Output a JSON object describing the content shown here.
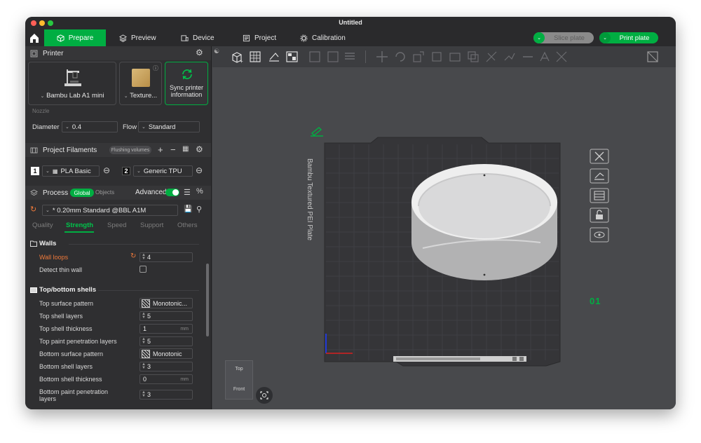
{
  "window": {
    "title": "Untitled"
  },
  "nav": {
    "tabs": [
      {
        "label": "Prepare",
        "active": true
      },
      {
        "label": "Preview"
      },
      {
        "label": "Device"
      },
      {
        "label": "Project"
      },
      {
        "label": "Calibration"
      }
    ],
    "slice_label": "Slice plate",
    "print_label": "Print plate"
  },
  "printer": {
    "section_title": "Printer",
    "model": "Bambu Lab A1 mini",
    "plate": "Texture...",
    "sync_label": "Sync printer information",
    "nozzle_label": "Nozzle",
    "diameter_label": "Diameter",
    "diameter_value": "0.4",
    "flow_label": "Flow",
    "flow_value": "Standard"
  },
  "filaments": {
    "section_title": "Project Filaments",
    "flushing_label": "Flushing volumes",
    "items": [
      {
        "index": "1",
        "name": "PLA Basic",
        "color": "#ffffff"
      },
      {
        "index": "2",
        "name": "Generic TPU",
        "color": "#111111"
      }
    ]
  },
  "process": {
    "section_title": "Process",
    "global_label": "Global",
    "objects_label": "Objects",
    "advanced_label": "Advanced",
    "advanced_on": true,
    "preset": "* 0.20mm Standard @BBL A1M",
    "tabs": [
      "Quality",
      "Strength",
      "Speed",
      "Support",
      "Others"
    ],
    "active_tab": "Strength"
  },
  "walls": {
    "title": "Walls",
    "wall_loops_label": "Wall loops",
    "wall_loops_value": "4",
    "detect_thin_label": "Detect thin wall",
    "detect_thin_checked": false
  },
  "shells": {
    "title": "Top/bottom shells",
    "rows": [
      {
        "label": "Top surface pattern",
        "value": "Monotonic...",
        "kind": "pattern"
      },
      {
        "label": "Top shell layers",
        "value": "5",
        "kind": "spin"
      },
      {
        "label": "Top shell thickness",
        "value": "1",
        "unit": "mm",
        "kind": "text"
      },
      {
        "label": "Top paint penetration layers",
        "value": "5",
        "kind": "spin"
      },
      {
        "label": "Bottom surface pattern",
        "value": "Monotonic",
        "kind": "pattern"
      },
      {
        "label": "Bottom shell layers",
        "value": "3",
        "kind": "spin"
      },
      {
        "label": "Bottom shell thickness",
        "value": "0",
        "unit": "mm",
        "kind": "text"
      },
      {
        "label": "Bottom paint penetration layers",
        "value": "3",
        "kind": "spin"
      }
    ]
  },
  "viewport": {
    "plate_text": "Bambu Textured PEI Plate",
    "plate_number": "01",
    "cube_top": "Top",
    "cube_front": "Front"
  },
  "colors": {
    "accent": "#00ae42",
    "changed": "#f07a3a",
    "window_bg": "#3c3d3f",
    "sidebar_bg": "#2f2f31",
    "viewport_bg": "#48494c"
  }
}
